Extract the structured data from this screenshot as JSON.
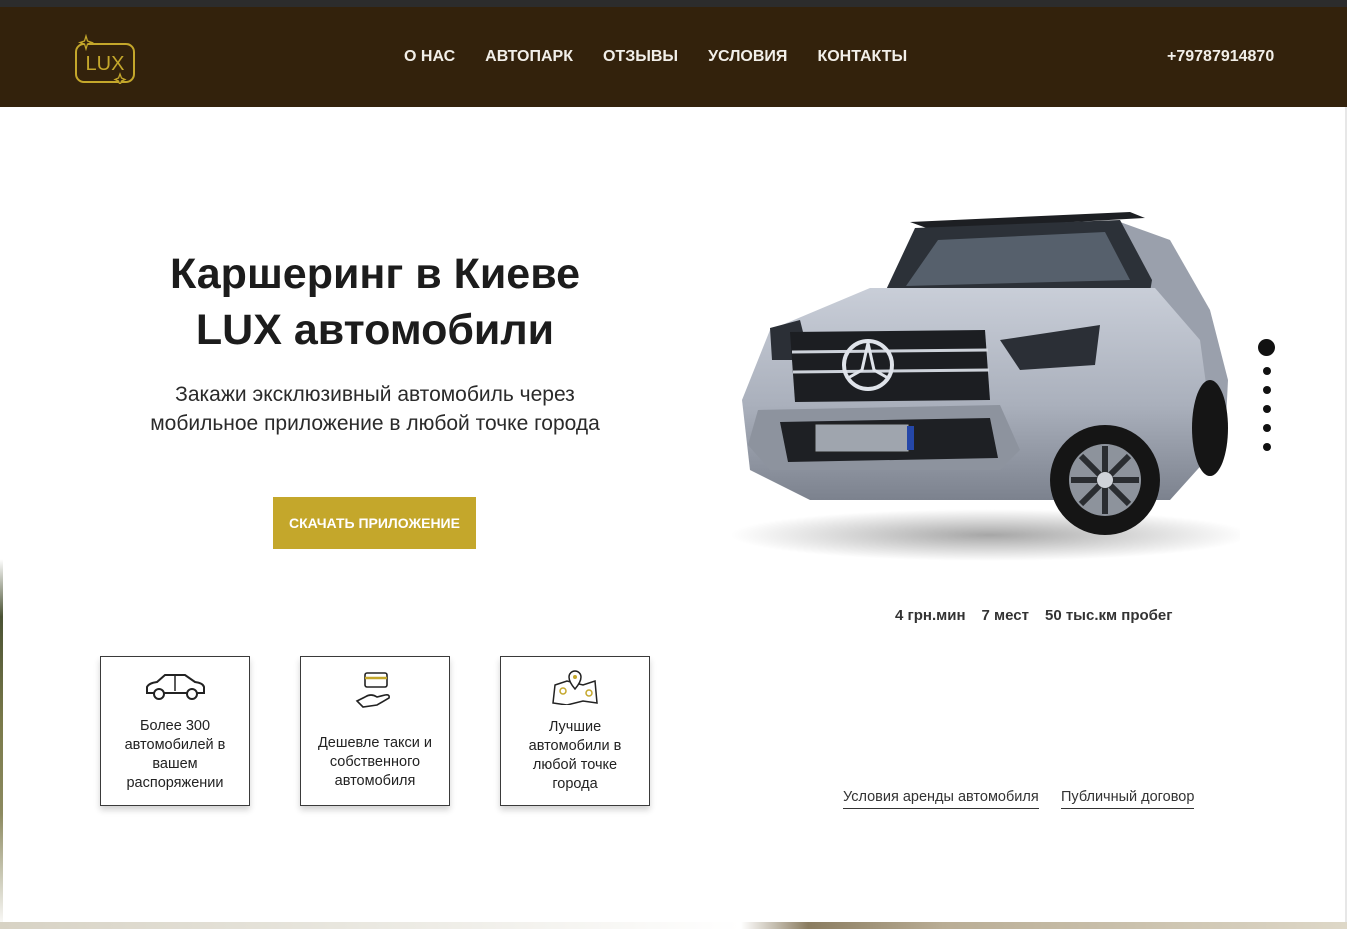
{
  "header": {
    "logo_text": "LUX",
    "nav": [
      "О НАС",
      "АВТОПАРК",
      "ОТЗЫВЫ",
      "УСЛОВИЯ",
      "КОНТАКТЫ"
    ],
    "phone": "+79787914870"
  },
  "hero": {
    "title_line1": "Каршеринг в Киеве",
    "title_line2": "LUX автомобили",
    "subtitle_line1": "Закажи эксклюзивный автомобиль через",
    "subtitle_line2": "мобильное приложение в любой точке города",
    "cta_label": "Скачать приложение"
  },
  "slider": {
    "slide_count": 6,
    "active_slide": 1
  },
  "car_specs": [
    "4 грн.мин",
    "7 мест",
    "50 тыс.км пробег"
  ],
  "features": [
    {
      "icon": "car-icon",
      "text": "Более 300 автомобилей в вашем распоряжении"
    },
    {
      "icon": "card-in-hand-icon",
      "text": "Дешевле такси и собственного автомобиля"
    },
    {
      "icon": "map-pin-icon",
      "text": "Лучшие автомобили в любой точке города"
    }
  ],
  "links": {
    "rental_terms": "Условия аренды автомобиля",
    "public_contract": "Публичный договор"
  },
  "colors": {
    "header_bg": "#33220c",
    "accent_gold": "#c4a72b",
    "nav_text": "#f2efe9"
  }
}
